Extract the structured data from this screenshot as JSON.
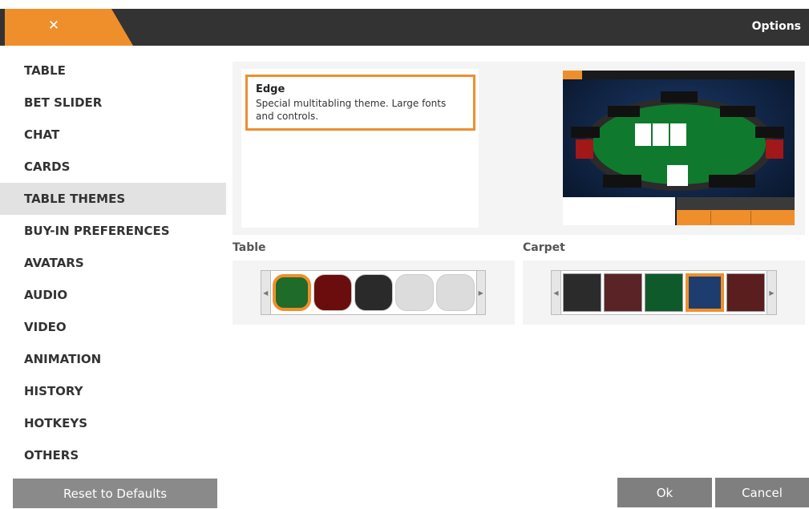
{
  "header": {
    "close_icon": "close-icon",
    "close_glyph": "✕",
    "title": "Options",
    "accent": "#ef8f2c"
  },
  "sidebar": {
    "items": [
      {
        "label": "TABLE"
      },
      {
        "label": "BET SLIDER"
      },
      {
        "label": "CHAT"
      },
      {
        "label": "CARDS"
      },
      {
        "label": "TABLE THEMES",
        "active": true
      },
      {
        "label": "BUY-IN PREFERENCES"
      },
      {
        "label": "AVATARS"
      },
      {
        "label": "AUDIO"
      },
      {
        "label": "VIDEO"
      },
      {
        "label": "ANIMATION"
      },
      {
        "label": "HISTORY"
      },
      {
        "label": "HOTKEYS"
      },
      {
        "label": "OTHERS"
      }
    ],
    "reset_label": "Reset to Defaults"
  },
  "theme": {
    "name": "Edge",
    "description": "Special multitabling theme. Large fonts and controls."
  },
  "table_picker": {
    "label": "Table",
    "swatches": [
      {
        "color": "#1e6b2a",
        "selected": true
      },
      {
        "color": "#6b0d0d",
        "selected": false
      },
      {
        "color": "#2a2a2a",
        "selected": false
      },
      {
        "color": "#dcdcdc",
        "selected": false
      },
      {
        "color": "#dcdcdc",
        "selected": false
      }
    ]
  },
  "carpet_picker": {
    "label": "Carpet",
    "swatches": [
      {
        "color": "#2b2b2b",
        "selected": false
      },
      {
        "color": "#5a2426",
        "selected": false
      },
      {
        "color": "#0f5a2a",
        "selected": false
      },
      {
        "color": "#1d3d6e",
        "selected": true
      },
      {
        "color": "#5a1e1e",
        "selected": false
      }
    ]
  },
  "buttons": {
    "ok": "Ok",
    "cancel": "Cancel"
  }
}
